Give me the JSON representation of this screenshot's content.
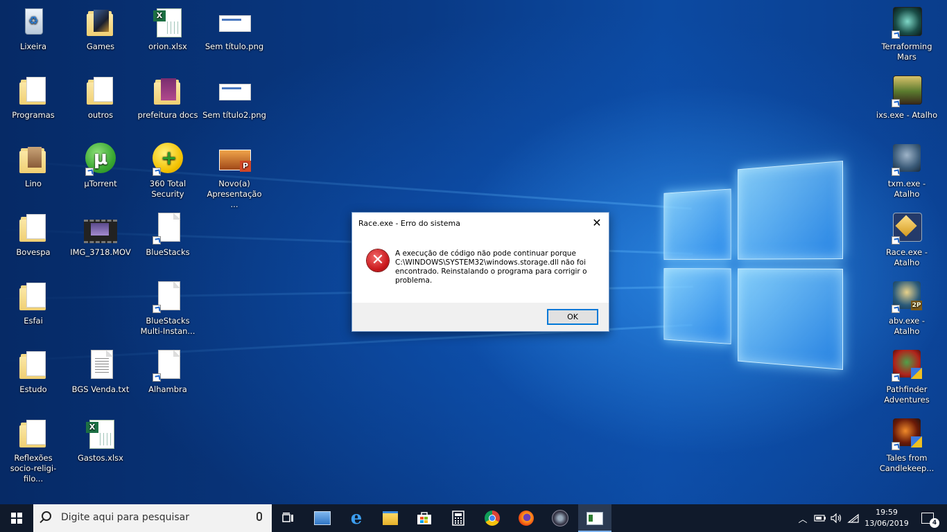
{
  "desktop": {
    "left_icons": [
      {
        "label": "Lixeira"
      },
      {
        "label": "Games"
      },
      {
        "label": "orion.xlsx"
      },
      {
        "label": "Sem título.png"
      },
      {
        "label": "Programas"
      },
      {
        "label": "outros"
      },
      {
        "label": "prefeitura docs"
      },
      {
        "label": "Sem título2.png"
      },
      {
        "label": "Lino"
      },
      {
        "label": "µTorrent"
      },
      {
        "label": "360 Total Security"
      },
      {
        "label": "Novo(a) Apresentação ..."
      },
      {
        "label": "Bovespa"
      },
      {
        "label": "IMG_3718.MOV"
      },
      {
        "label": "BlueStacks"
      },
      {
        "label": "Esfai"
      },
      {
        "label": "BlueStacks Multi-Instan..."
      },
      {
        "label": "Estudo"
      },
      {
        "label": "BGS Venda.txt"
      },
      {
        "label": "Alhambra"
      },
      {
        "label": "Reflexões socio-religi-filo..."
      },
      {
        "label": "Gastos.xlsx"
      }
    ],
    "right_icons": [
      {
        "label": "Terraforming Mars"
      },
      {
        "label": "ixs.exe - Atalho"
      },
      {
        "label": "txm.exe - Atalho"
      },
      {
        "label": "Race.exe - Atalho"
      },
      {
        "label": "abv.exe - Atalho"
      },
      {
        "label": "Pathfinder Adventures"
      },
      {
        "label": "Tales from Candlekeep..."
      }
    ]
  },
  "dialog": {
    "title": "Race.exe - Erro do sistema",
    "close_glyph": "✕",
    "error_glyph": "✕",
    "message": "A execução de código não pode continuar porque C:\\WINDOWS\\SYSTEM32\\windows.storage.dll não foi encontrado. Reinstalando o programa para corrigir o problema.",
    "ok_label": "OK"
  },
  "taskbar": {
    "search_placeholder": "Digite aqui para pesquisar",
    "apps": [
      "task-view",
      "outlook-express",
      "edge",
      "file-explorer",
      "store",
      "calculator",
      "chrome",
      "firefox",
      "ai-suite",
      "active-window"
    ],
    "clock_time": "19:59",
    "clock_date": "13/06/2019",
    "notification_count": "4"
  }
}
